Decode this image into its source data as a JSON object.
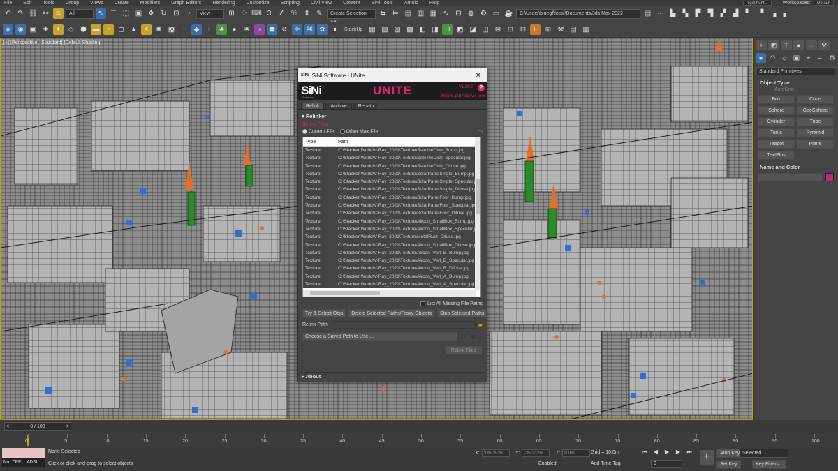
{
  "menu": {
    "items": [
      "File",
      "Edit",
      "Tools",
      "Group",
      "Views",
      "Create",
      "Modifiers",
      "Graph Editors",
      "Rendering",
      "Customize",
      "Scripting",
      "Civil View",
      "Content",
      "SiNi Tools",
      "Arnold",
      "Help"
    ],
    "user": "nigel.hunt...",
    "workspaces_label": "Workspaces:",
    "workspace": "Default"
  },
  "toolbar": {
    "filter": "All",
    "view": "View",
    "selection_set": "Create Selection Se",
    "project_path": "C:\\Users\\bluegf\\local\\Documents\\3ds Max 2022",
    "stackup": "StackUp"
  },
  "viewport": {
    "label": "[+] [Perspective] [Standard] [Default Shading]"
  },
  "command_panel": {
    "category": "Standard Primitives",
    "object_type": "Object Type",
    "autogrid": "AutoGrid",
    "primitives": [
      "Box",
      "Cone",
      "Sphere",
      "GeoSphere",
      "Cylinder",
      "Tube",
      "Torus",
      "Pyramid",
      "Teapot",
      "Plane",
      "TextPlus"
    ],
    "name_and_color": "Name and Color",
    "color": "#c4257a"
  },
  "timeline": {
    "frame": "0 / 100",
    "ticks": [
      "0",
      "5",
      "10",
      "15",
      "20",
      "25",
      "30",
      "35",
      "40",
      "45",
      "50",
      "55",
      "60",
      "65",
      "70",
      "75",
      "80",
      "85",
      "90",
      "95",
      "100"
    ]
  },
  "status": {
    "script": "No CRP, ADSL",
    "selection": "None Selected",
    "prompt": "Click or click-and-drag to select objects",
    "x_label": "X:",
    "x": "335.352m",
    "y_label": "Y:",
    "y": "-35.232m",
    "z_label": "Z:",
    "z": "0.0m",
    "grid": "Grid = 10.0m",
    "add_time_tag": "Add Time Tag",
    "enabled": "Enabled:",
    "auto_key": "Auto Key",
    "selected": "Selected",
    "set_key": "Set Key",
    "key_filters": "Key Filters...",
    "frame": "0"
  },
  "dialog": {
    "title": "SiNi Software - UNite",
    "logo": "SiNi",
    "logo_sub": "Software",
    "product": "UNITE",
    "version": "V1.29.0",
    "help": "?",
    "tagline": "Relink and Archive Tool",
    "tabs": [
      "Relink",
      "Archive",
      "Repath"
    ],
    "relinker": "Relinker",
    "relink_files": "Relink Files",
    "radio_current": "Current File",
    "radio_other": "Other Max File",
    "col_type": "Type",
    "col_path": "Path",
    "rows": [
      {
        "type": "Texture",
        "path": "C:\\Stacker World\\V-Ray_2021\\Texture\\SatelliteDish_Bump.jpg"
      },
      {
        "type": "Texture",
        "path": "C:\\Stacker World\\V-Ray_2021\\Texture\\SatelliteDish_Specular.jpg"
      },
      {
        "type": "Texture",
        "path": "C:\\Stacker World\\V-Ray_2021\\Texture\\SatelliteDish_Difuse.jpg"
      },
      {
        "type": "Texture",
        "path": "C:\\Stacker World\\V-Ray_2021\\Texture\\SolarPanelSingle_Bump.jpg"
      },
      {
        "type": "Texture",
        "path": "C:\\Stacker World\\V-Ray_2021\\Texture\\SolarPanelSingle_Specular.jpg"
      },
      {
        "type": "Texture",
        "path": "C:\\Stacker World\\V-Ray_2021\\Texture\\SolarPanelSingle_Difuse.jpg"
      },
      {
        "type": "Texture",
        "path": "C:\\Stacker World\\V-Ray_2021\\Texture\\SolarPanelFour_Bump.jpg"
      },
      {
        "type": "Texture",
        "path": "C:\\Stacker World\\V-Ray_2021\\Texture\\SolarPanelFour_Specular.jpg"
      },
      {
        "type": "Texture",
        "path": "C:\\Stacker World\\V-Ray_2021\\Texture\\SolarPanelFour_Difuse.jpg"
      },
      {
        "type": "Texture",
        "path": "C:\\Stacker World\\V-Ray_2021\\Texture\\Aircon_SmallBox_Bump.jpg"
      },
      {
        "type": "Texture",
        "path": "C:\\Stacker World\\V-Ray_2021\\Texture\\Aircon_SmallBox_Specular.jpg"
      },
      {
        "type": "Texture",
        "path": "C:\\Stacker World\\V-Ray_2021\\Texture\\MetalRust_Difuse.jpg"
      },
      {
        "type": "Texture",
        "path": "C:\\Stacker World\\V-Ray_2021\\Texture\\Aircon_SmallBox_Difuse.jpg"
      },
      {
        "type": "Texture",
        "path": "C:\\Stacker World\\V-Ray_2021\\Texture\\Aircon_Vert_B_Bump.jpg"
      },
      {
        "type": "Texture",
        "path": "C:\\Stacker World\\V-Ray_2021\\Texture\\Aircon_Vert_B_Specular.jpg"
      },
      {
        "type": "Texture",
        "path": "C:\\Stacker World\\V-Ray_2021\\Texture\\Aircon_Vert_B_Difuse.jpg"
      },
      {
        "type": "Texture",
        "path": "C:\\Stacker World\\V-Ray_2021\\Texture\\Aircon_Vert_A_Bump.jpg"
      },
      {
        "type": "Texture",
        "path": "C:\\Stacker World\\V-Ray_2021\\Texture\\Aircon_Vert_A_Specular.jpg"
      }
    ],
    "list_all": "List All Missing File Paths",
    "btn_try": "Try & Select Objs",
    "btn_delete": "Delete Selected Paths/Proxy Objects",
    "btn_strip": "Strip Selected Paths",
    "relink_path": "Relink Path:",
    "saved_path": "Choose a Saved Path to Use ...",
    "btn_relink": "Relink Files",
    "about": "About",
    "accent": "#e0266f"
  }
}
